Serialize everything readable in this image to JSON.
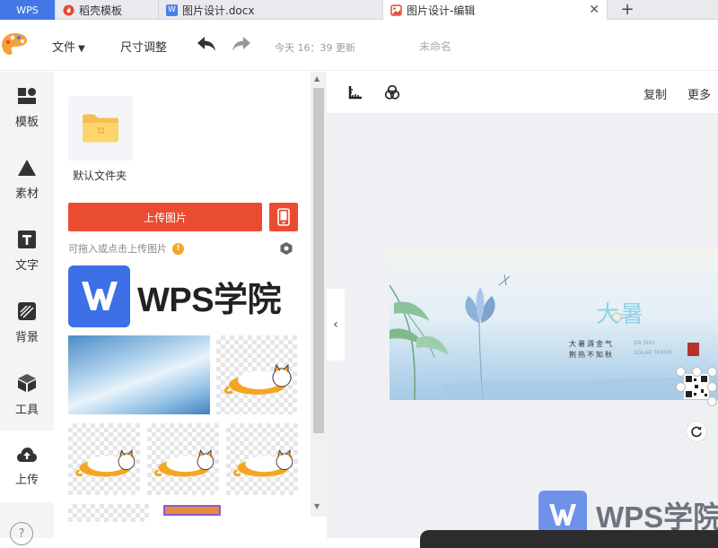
{
  "tabs": [
    {
      "label": "WPS"
    },
    {
      "label": "稻壳模板"
    },
    {
      "label": "图片设计.docx"
    },
    {
      "label": "图片设计-编辑"
    }
  ],
  "toolbar": {
    "file_menu": "文件",
    "resize_menu": "尺寸调整",
    "save_status": "今天 16：39 更新",
    "doc_name": "未命名"
  },
  "rail": {
    "items": [
      {
        "label": "模板"
      },
      {
        "label": "素材"
      },
      {
        "label": "文字"
      },
      {
        "label": "背景"
      },
      {
        "label": "工具"
      },
      {
        "label": "上传"
      }
    ],
    "help": "?"
  },
  "panel": {
    "folder_label": "默认文件夹",
    "upload_button": "上传图片",
    "drop_hint": "可拖入或点击上传图片",
    "warn_glyph": "!",
    "wps_logo_text": "WPS学院"
  },
  "canvas": {
    "copy": "复制",
    "more": "更多",
    "poster": {
      "title": "大暑",
      "line1": "大暑溽金气",
      "line2": "荆热不知秋",
      "en1": "DA SHU",
      "en2": "SOLAR TERMS"
    },
    "watermark": "WPS学院"
  },
  "colors": {
    "accent_red": "#ea4c32",
    "wps_blue": "#3d6fe6",
    "tab_active_bg": "#ffffff",
    "wps_tab_bg": "#4377e6"
  }
}
